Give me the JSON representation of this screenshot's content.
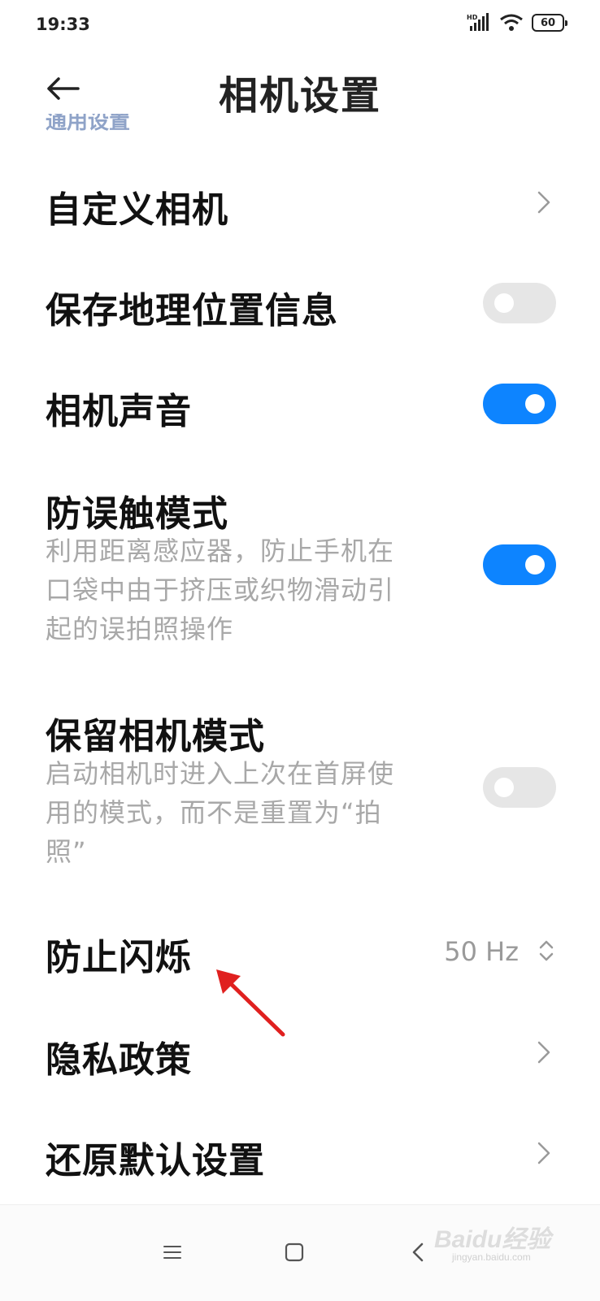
{
  "status_bar": {
    "time": "19:33",
    "network_label": "HD",
    "battery_level": "60",
    "icons": [
      "signal-icon",
      "wifi-icon",
      "battery-icon"
    ]
  },
  "header": {
    "title": "相机设置",
    "back_icon": "back-arrow-icon"
  },
  "section": {
    "label": "通用设置"
  },
  "settings": {
    "custom_camera": {
      "title": "自定义相机",
      "control": "chevron"
    },
    "save_location": {
      "title": "保存地理位置信息",
      "control": "toggle",
      "enabled": false
    },
    "camera_sound": {
      "title": "相机声音",
      "control": "toggle",
      "enabled": true
    },
    "anti_touch": {
      "title": "防误触模式",
      "desc_lines": [
        "利用距离感应器，防止手机在",
        "口袋中由于挤压或织物滑动引",
        "起的误拍照操作"
      ],
      "control": "toggle",
      "enabled": true
    },
    "keep_mode": {
      "title": "保留相机模式",
      "desc_lines": [
        "启动相机时进入上次在首屏使",
        "用的模式，而不是重置为“拍",
        "照”"
      ],
      "control": "toggle",
      "enabled": false
    },
    "anti_flicker": {
      "title": "防止闪烁",
      "value": "50 Hz",
      "control": "selector"
    },
    "privacy": {
      "title": "隐私政策",
      "control": "chevron"
    },
    "restore": {
      "title": "还原默认设置",
      "control": "chevron"
    }
  },
  "nav_bar": {
    "menu_icon": "menu-icon",
    "home_icon": "home-square-icon",
    "back_icon": "back-triangle-icon"
  },
  "watermark": {
    "text": "Baidu经验",
    "sub": "jingyan.baidu.com"
  },
  "colors": {
    "accent": "#0d84ff",
    "toggle_off": "#e6e6e6",
    "secondary_text": "#a8a8a8",
    "annotation_arrow": "#e0201f"
  }
}
